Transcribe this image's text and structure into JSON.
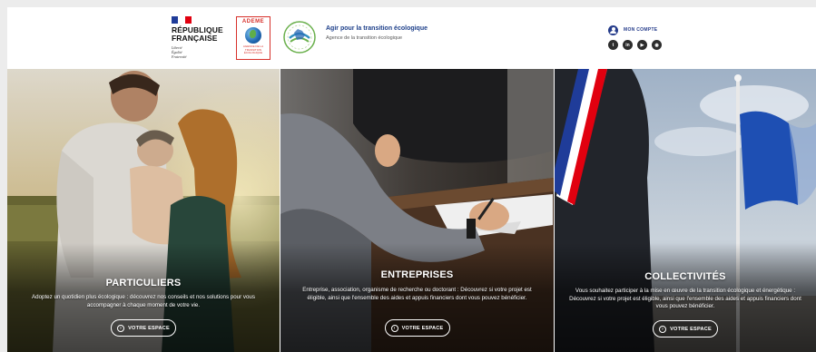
{
  "header": {
    "republique": {
      "line1": "RÉPUBLIQUE",
      "line2": "FRANÇAISE",
      "motto": [
        "Liberté",
        "Égalité",
        "Fraternité"
      ],
      "flag_colors": [
        "#1f3c99",
        "#ffffff",
        "#e1000f"
      ]
    },
    "ademe": {
      "name": "ADEME",
      "subtitle": "AGENCE DE LA TRANSITION ÉCOLOGIQUE"
    },
    "relance_logo": {
      "icon": "france-relance-logo"
    },
    "tagline": {
      "title": "Agir pour la transition écologique",
      "subtitle": "Agence de la transition écologique"
    },
    "account": {
      "label": "MON COMPTE",
      "icon": "user-icon"
    },
    "socials": [
      {
        "name": "twitter",
        "glyph": "t"
      },
      {
        "name": "linkedin",
        "glyph": "in"
      },
      {
        "name": "youtube",
        "glyph": "▶"
      },
      {
        "name": "rss",
        "glyph": "◉"
      }
    ]
  },
  "panels": [
    {
      "title": "PARTICULIERS",
      "description": "Adoptez un quotidien plus écologique : découvrez nos conseils et nos solutions pour vous accompagner à chaque moment de votre vie.",
      "button_label": "VOTRE ESPACE"
    },
    {
      "title": "ENTREPRISES",
      "description": "Entreprise, association, organisme de recherche ou doctorant : Découvrez si votre projet est éligible, ainsi que l'ensemble des aides et appuis financiers dont vous pouvez bénéficier.",
      "button_label": "VOTRE ESPACE"
    },
    {
      "title": "COLLECTIVITÉS",
      "description": "Vous souhaitez participer à la mise en œuvre de la transition écologique et énergétique : Découvrez si votre projet est éligible, ainsi que l'ensemble des aides et appuis financiers dont vous pouvez bénéficier.",
      "button_label": "VOTRE ESPACE"
    }
  ],
  "colors": {
    "brand_blue": "#1d3f8a",
    "ademe_red": "#d7302a"
  }
}
